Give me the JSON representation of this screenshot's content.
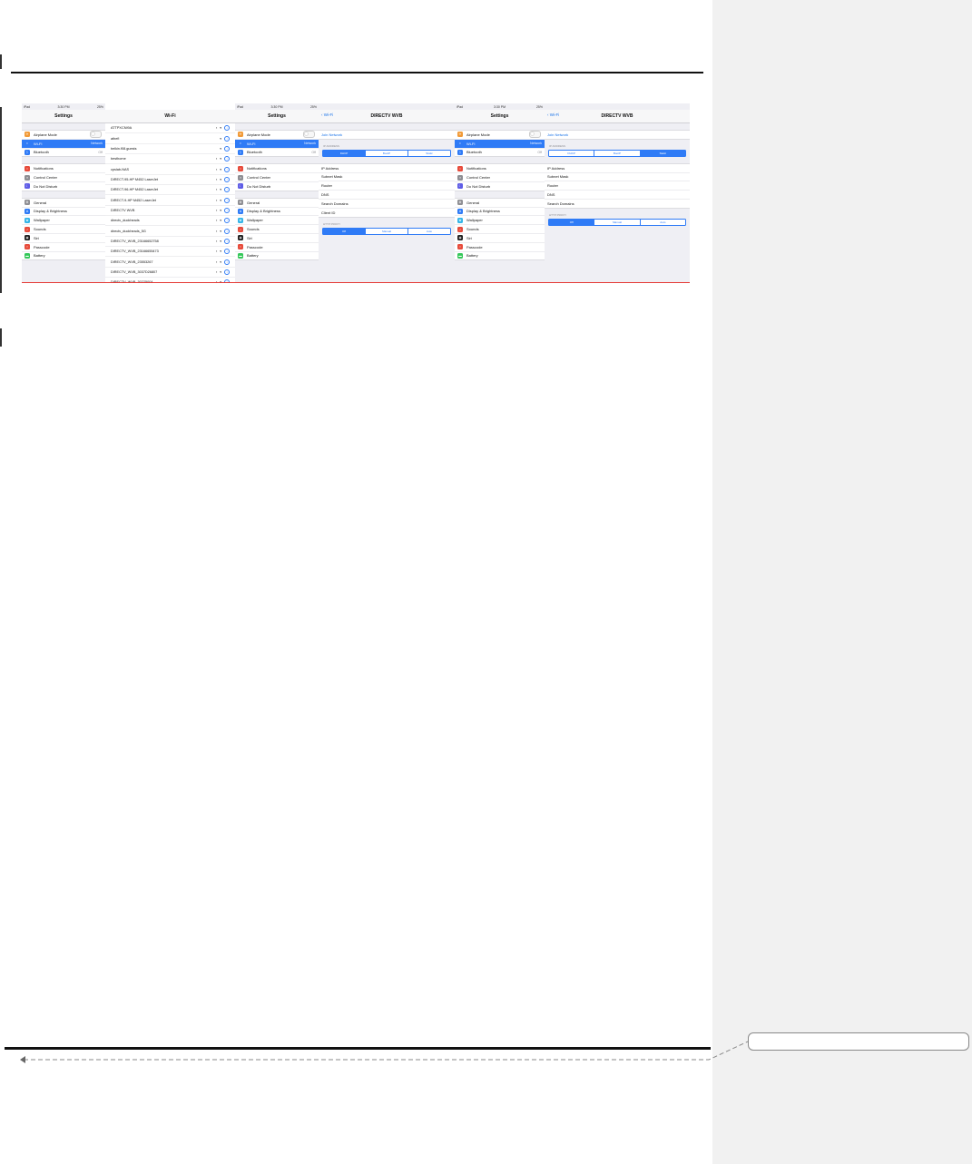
{
  "layout_marks": {
    "accent": "#e53935",
    "rule": "#111111",
    "margin_bg": "#f1f1f1"
  },
  "panel1": {
    "status": {
      "left": "iPad",
      "time": "3:30 PM",
      "battery": "25%"
    },
    "title": "Settings",
    "groups": [
      [
        {
          "label": "Airplane Mode",
          "icon": "airplane-icon",
          "color": "#f19a37",
          "toggle": true
        },
        {
          "label": "Wi-Fi",
          "icon": "wifi-icon",
          "color": "#2f7bf6",
          "value": "Network",
          "selected": true
        },
        {
          "label": "Bluetooth",
          "icon": "bluetooth-icon",
          "color": "#2f7bf6",
          "value": "Off"
        }
      ],
      [
        {
          "label": "Notifications",
          "icon": "notifications-icon",
          "color": "#e74c3c"
        },
        {
          "label": "Control Center",
          "icon": "control-center-icon",
          "color": "#8e8e93"
        },
        {
          "label": "Do Not Disturb",
          "icon": "moon-icon",
          "color": "#5e5ce6"
        }
      ],
      [
        {
          "label": "General",
          "icon": "gear-icon",
          "color": "#8e8e93"
        },
        {
          "label": "Display & Brightness",
          "icon": "display-icon",
          "color": "#2f7bf6"
        },
        {
          "label": "Wallpaper",
          "icon": "wallpaper-icon",
          "color": "#36b5e8"
        },
        {
          "label": "Sounds",
          "icon": "sound-icon",
          "color": "#e74c3c"
        },
        {
          "label": "Siri",
          "icon": "siri-icon",
          "color": "#222"
        },
        {
          "label": "Passcode",
          "icon": "lock-icon",
          "color": "#e74c3c"
        },
        {
          "label": "Battery",
          "icon": "battery-icon",
          "color": "#34c759"
        }
      ]
    ]
  },
  "panel2": {
    "title": "Wi-Fi",
    "networks": [
      {
        "name": "ATTPXCNI9A",
        "lock": true
      },
      {
        "name": "athefi",
        "lock": false
      },
      {
        "name": "belkin.f08.guests",
        "lock": false
      },
      {
        "name": "besthome",
        "lock": true
      },
      {
        "name": "cpslab-NAS",
        "lock": true
      },
      {
        "name": "DIRECT-95-HP M452 LaserJet",
        "lock": true
      },
      {
        "name": "DIRECT-96-HP M452 LaserJet",
        "lock": true
      },
      {
        "name": "DIRECT-9-HP M452 LaserJet",
        "lock": true
      },
      {
        "name": "DIRECTV WVB",
        "lock": true
      },
      {
        "name": "directv_duckheads",
        "lock": true
      },
      {
        "name": "directv_duckheads_5G",
        "lock": true
      },
      {
        "name": "DIRECTV_WVB_23166652758",
        "lock": true
      },
      {
        "name": "DIRECTV_WVB_23166655473",
        "lock": true
      },
      {
        "name": "DIRECTV_WVB_23553267",
        "lock": true
      },
      {
        "name": "DIRECTV_WVB_3037D26807",
        "lock": true
      },
      {
        "name": "DIRECTV_WVB_30225004",
        "lock": true
      }
    ]
  },
  "panel3": {
    "status": {
      "left": "iPad",
      "time": "3:30 PM",
      "battery": "25%"
    },
    "title": "Settings",
    "groups": [
      [
        {
          "label": "Airplane Mode",
          "icon": "airplane-icon",
          "color": "#f19a37",
          "toggle": true
        },
        {
          "label": "Wi-Fi",
          "icon": "wifi-icon",
          "color": "#2f7bf6",
          "value": "Network",
          "selected": true
        },
        {
          "label": "Bluetooth",
          "icon": "bluetooth-icon",
          "color": "#2f7bf6",
          "value": "Off"
        }
      ],
      [
        {
          "label": "Notifications",
          "icon": "notifications-icon",
          "color": "#e74c3c"
        },
        {
          "label": "Control Center",
          "icon": "control-center-icon",
          "color": "#8e8e93"
        },
        {
          "label": "Do Not Disturb",
          "icon": "moon-icon",
          "color": "#5e5ce6"
        }
      ],
      [
        {
          "label": "General",
          "icon": "gear-icon",
          "color": "#8e8e93"
        },
        {
          "label": "Display & Brightness",
          "icon": "display-icon",
          "color": "#2f7bf6"
        },
        {
          "label": "Wallpaper",
          "icon": "wallpaper-icon",
          "color": "#36b5e8"
        },
        {
          "label": "Sounds",
          "icon": "sound-icon",
          "color": "#e74c3c"
        },
        {
          "label": "Siri",
          "icon": "siri-icon",
          "color": "#222"
        },
        {
          "label": "Passcode",
          "icon": "lock-icon",
          "color": "#e74c3c"
        },
        {
          "label": "Battery",
          "icon": "battery-icon",
          "color": "#34c759"
        }
      ]
    ]
  },
  "panel4": {
    "back": "Wi-Fi",
    "title": "DIRECTV WVB",
    "join": "Join Network",
    "ip_label": "IP ADDRESS",
    "ip_seg": [
      "DHCP",
      "BootP",
      "Static"
    ],
    "ip_on": 0,
    "fields": [
      "IP Address",
      "Subnet Mask",
      "Router",
      "DNS",
      "Search Domains",
      "Client ID"
    ],
    "proxy_label": "HTTP PROXY",
    "proxy_seg": [
      "Off",
      "Manual",
      "Auto"
    ],
    "proxy_on": 0
  },
  "panel5": {
    "status": {
      "left": "iPad",
      "time": "3:30 PM",
      "battery": "25%"
    },
    "title": "Settings",
    "groups": [
      [
        {
          "label": "Airplane Mode",
          "icon": "airplane-icon",
          "color": "#f19a37",
          "toggle": true
        },
        {
          "label": "Wi-Fi",
          "icon": "wifi-icon",
          "color": "#2f7bf6",
          "value": "Network",
          "selected": true
        },
        {
          "label": "Bluetooth",
          "icon": "bluetooth-icon",
          "color": "#2f7bf6",
          "value": "Off"
        }
      ],
      [
        {
          "label": "Notifications",
          "icon": "notifications-icon",
          "color": "#e74c3c"
        },
        {
          "label": "Control Center",
          "icon": "control-center-icon",
          "color": "#8e8e93"
        },
        {
          "label": "Do Not Disturb",
          "icon": "moon-icon",
          "color": "#5e5ce6"
        }
      ],
      [
        {
          "label": "General",
          "icon": "gear-icon",
          "color": "#8e8e93"
        },
        {
          "label": "Display & Brightness",
          "icon": "display-icon",
          "color": "#2f7bf6"
        },
        {
          "label": "Wallpaper",
          "icon": "wallpaper-icon",
          "color": "#36b5e8"
        },
        {
          "label": "Sounds",
          "icon": "sound-icon",
          "color": "#e74c3c"
        },
        {
          "label": "Siri",
          "icon": "siri-icon",
          "color": "#222"
        },
        {
          "label": "Passcode",
          "icon": "lock-icon",
          "color": "#e74c3c"
        },
        {
          "label": "Battery",
          "icon": "battery-icon",
          "color": "#34c759"
        }
      ]
    ]
  },
  "panel6": {
    "back": "Wi-Fi",
    "title": "DIRECTV WVB",
    "join": "Join Network",
    "ip_label": "IP ADDRESS",
    "ip_seg": [
      "DHCP",
      "BootP",
      "Static"
    ],
    "ip_on": 2,
    "fields": [
      "IP Address",
      "Subnet Mask",
      "Router",
      "DNS",
      "Search Domains"
    ],
    "proxy_label": "HTTP PROXY",
    "proxy_seg": [
      "Off",
      "Manual",
      "Auto"
    ],
    "proxy_on": 0
  }
}
